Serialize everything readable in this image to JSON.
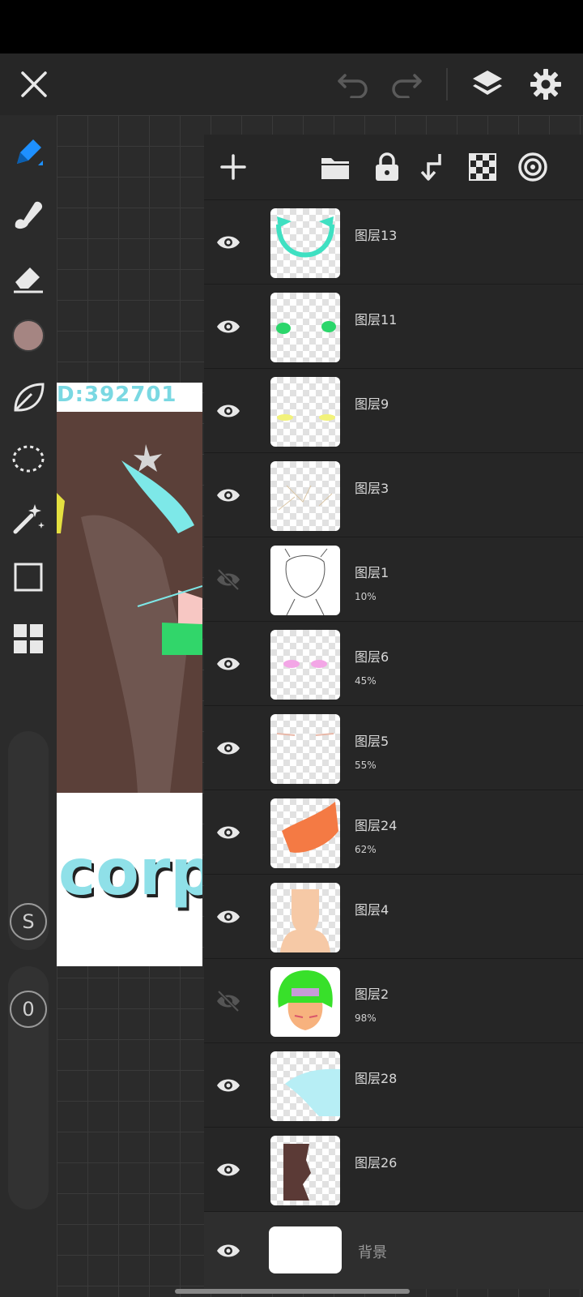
{
  "toolbar": {
    "close": "close",
    "undo": "undo",
    "redo": "redo",
    "layers": "layers",
    "settings": "settings"
  },
  "tools": {
    "color": "#a58582",
    "brush_size_label": "S",
    "opacity_label": "0"
  },
  "artwork": {
    "id_text": "D:392701",
    "word": "corps"
  },
  "layers_toolbar": [
    "add-layer",
    "import-folder",
    "lock",
    "merge-down",
    "transparency",
    "blend-mode"
  ],
  "layers": [
    {
      "name": "图层13",
      "opacity": "",
      "visible": true
    },
    {
      "name": "图层11",
      "opacity": "",
      "visible": true
    },
    {
      "name": "图层9",
      "opacity": "",
      "visible": true
    },
    {
      "name": "图层3",
      "opacity": "",
      "visible": true
    },
    {
      "name": "图层1",
      "opacity": "10%",
      "visible": false
    },
    {
      "name": "图层6",
      "opacity": "45%",
      "visible": true
    },
    {
      "name": "图层5",
      "opacity": "55%",
      "visible": true
    },
    {
      "name": "图层24",
      "opacity": "62%",
      "visible": true
    },
    {
      "name": "图层4",
      "opacity": "",
      "visible": true
    },
    {
      "name": "图层2",
      "opacity": "98%",
      "visible": false
    },
    {
      "name": "图层28",
      "opacity": "",
      "visible": true
    },
    {
      "name": "图层26",
      "opacity": "",
      "visible": true
    },
    {
      "name": "背景",
      "opacity": "",
      "visible": true
    }
  ]
}
